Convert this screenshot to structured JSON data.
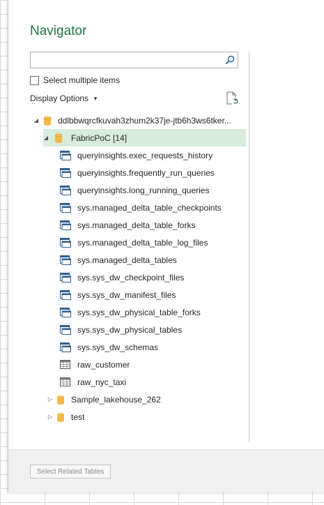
{
  "dialog": {
    "title": "Navigator",
    "search": {
      "placeholder": "",
      "value": ""
    },
    "select_multiple_label": "Select multiple items",
    "display_options_label": "Display Options",
    "colors": {
      "accent": "#217346",
      "selected_bg": "#d7ecdc"
    }
  },
  "tree": {
    "root": {
      "label": "ddlbbwqrcfkuvah3zhum2k37je-jtb6h3ws6tker...",
      "expanded": true
    },
    "selected_db": {
      "label": "FabricPoC [14]",
      "expanded": true
    },
    "items": [
      {
        "label": "queryinsights.exec_requests_history",
        "icon": "view-icon"
      },
      {
        "label": "queryinsights.frequently_run_queries",
        "icon": "view-icon"
      },
      {
        "label": "queryinsights.long_running_queries",
        "icon": "view-icon"
      },
      {
        "label": "sys.managed_delta_table_checkpoints",
        "icon": "view-icon"
      },
      {
        "label": "sys.managed_delta_table_forks",
        "icon": "view-icon"
      },
      {
        "label": "sys.managed_delta_table_log_files",
        "icon": "view-icon"
      },
      {
        "label": "sys.managed_delta_tables",
        "icon": "view-icon"
      },
      {
        "label": "sys.sys_dw_checkpoint_files",
        "icon": "view-icon"
      },
      {
        "label": "sys.sys_dw_manifest_files",
        "icon": "view-icon"
      },
      {
        "label": "sys.sys_dw_physical_table_forks",
        "icon": "view-icon"
      },
      {
        "label": "sys.sys_dw_physical_tables",
        "icon": "view-icon"
      },
      {
        "label": "sys.sys_dw_schemas",
        "icon": "view-icon"
      },
      {
        "label": "raw_customer",
        "icon": "table-icon"
      },
      {
        "label": "raw_nyc_taxi",
        "icon": "table-icon"
      }
    ],
    "other_dbs": [
      {
        "label": "Sample_lakehouse_262",
        "expanded": false
      },
      {
        "label": "test",
        "expanded": false
      }
    ]
  },
  "footer": {
    "select_related_label": "Select Related Tables"
  }
}
